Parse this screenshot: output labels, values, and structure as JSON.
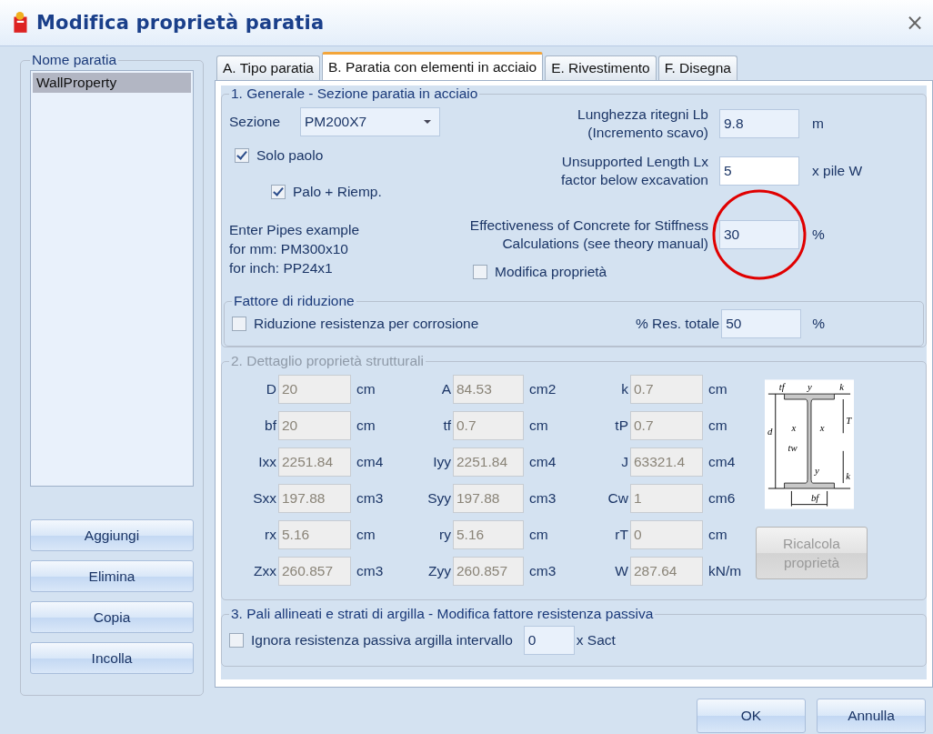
{
  "window": {
    "title": "Modifica proprietà paratia",
    "close": "×"
  },
  "sidebar": {
    "title": "Nome paratia",
    "items": [
      {
        "label": "WallProperty",
        "selected": true
      }
    ],
    "buttons": [
      "Aggiungi",
      "Elimina",
      "Copia",
      "Incolla"
    ]
  },
  "tabs": [
    {
      "label": "A. Tipo paratia",
      "selected": false
    },
    {
      "label": "B. Paratia con elementi in acciaio",
      "selected": true
    },
    {
      "label": "E. Rivestimento",
      "selected": false
    },
    {
      "label": "F. Disegna",
      "selected": false
    }
  ],
  "general": {
    "title": "1. Generale - Sezione paratia in acciaio",
    "section": {
      "label": "Sezione",
      "value": "PM200X7"
    },
    "checkboxes": [
      {
        "label": "Solo paolo",
        "checked": true
      },
      {
        "label": "Palo + Riemp.",
        "checked": true
      }
    ],
    "example": [
      "Enter Pipes example",
      "for mm: PM300x10",
      "for inch: PP24x1"
    ],
    "fields": [
      {
        "label": [
          "Lunghezza ritegni Lb",
          "(Incremento scavo)"
        ],
        "value": "9.8",
        "unit": "m",
        "focused": false
      },
      {
        "label": [
          "Unsupported Length Lx",
          "factor below excavation"
        ],
        "value": "5",
        "unit": "x pile W",
        "focused": true
      },
      {
        "label": [
          "Effectiveness of Concrete for Stiffness",
          "Calculations (see theory manual)"
        ],
        "value": "30",
        "unit": "%",
        "focused": false
      }
    ],
    "modify": {
      "label": "Modifica proprietà",
      "checked": false
    }
  },
  "reduction": {
    "title": "Fattore di riduzione",
    "checkbox": {
      "label": "Riduzione resistenza per corrosione",
      "checked": false
    },
    "field": {
      "label": "% Res. totale",
      "value": "50",
      "unit": "%"
    }
  },
  "structural": {
    "title": "2. Dettaglio proprietà strutturali",
    "disabled": true,
    "properties": [
      {
        "label": "D",
        "value": "20",
        "unit": "cm"
      },
      {
        "label": "A",
        "value": "84.53",
        "unit": "cm2"
      },
      {
        "label": "k",
        "value": "0.7",
        "unit": "cm"
      },
      {
        "label": "bf",
        "value": "20",
        "unit": "cm"
      },
      {
        "label": "tf",
        "value": "0.7",
        "unit": "cm"
      },
      {
        "label": "tP",
        "value": "0.7",
        "unit": "cm"
      },
      {
        "label": "Ixx",
        "value": "2251.84",
        "unit": "cm4"
      },
      {
        "label": "Iyy",
        "value": "2251.84",
        "unit": "cm4"
      },
      {
        "label": "J",
        "value": "63321.4",
        "unit": "cm4"
      },
      {
        "label": "Sxx",
        "value": "197.88",
        "unit": "cm3"
      },
      {
        "label": "Syy",
        "value": "197.88",
        "unit": "cm3"
      },
      {
        "label": "Cw",
        "value": "1",
        "unit": "cm6"
      },
      {
        "label": "rx",
        "value": "5.16",
        "unit": "cm"
      },
      {
        "label": "ry",
        "value": "5.16",
        "unit": "cm"
      },
      {
        "label": "rT",
        "value": "0",
        "unit": "cm"
      },
      {
        "label": "Zxx",
        "value": "260.857",
        "unit": "cm3"
      },
      {
        "label": "Zyy",
        "value": "260.857",
        "unit": "cm3"
      },
      {
        "label": "W",
        "value": "287.64",
        "unit": "kN/m"
      }
    ],
    "beam_labels": [
      "tf",
      "y",
      "k",
      "d",
      "x",
      "x",
      "T",
      "tw",
      "y",
      "k",
      "bf"
    ],
    "recalc_button": {
      "label": [
        "Ricalcola",
        "proprietà"
      ],
      "disabled": true
    }
  },
  "passive": {
    "title": "3. Pali allineati e strati di argilla - Modifica fattore resistenza passiva",
    "checkbox": {
      "label": "Ignora resistenza passiva argilla intervallo",
      "checked": false
    },
    "field": {
      "value": "0",
      "unit": "x Sact"
    }
  },
  "buttons": [
    "OK",
    "Annulla"
  ],
  "annotation": {
    "kind": "ellipse"
  }
}
